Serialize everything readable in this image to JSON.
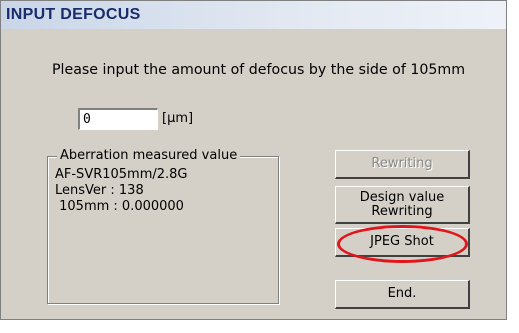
{
  "window": {
    "title": "INPUT DEFOCUS"
  },
  "prompt": {
    "text": "Please input the amount of defocus by the side of  105mm"
  },
  "defocus_input": {
    "value": "0",
    "unit": "[μm]"
  },
  "aberration": {
    "legend": "Aberration measured value",
    "lens_name": "AF-SVR105mm/2.8G",
    "lens_ver": "LensVer : 138",
    "measurement": " 105mm : 0.000000"
  },
  "buttons": {
    "rewriting": "Rewriting",
    "design_value_line1": "Design value",
    "design_value_line2": "Rewriting",
    "jpeg_shot": "JPEG Shot",
    "end": "End."
  },
  "annotation": {
    "highlight_color": "#e0161c"
  }
}
